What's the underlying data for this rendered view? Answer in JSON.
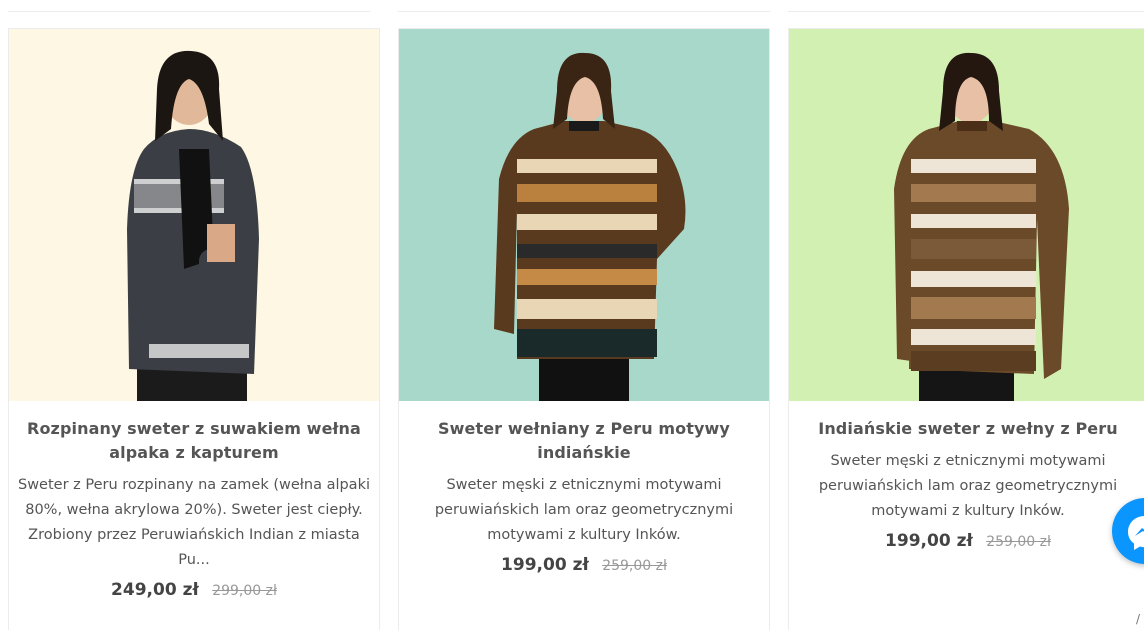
{
  "products": [
    {
      "title": "Rozpinany sweter z suwakiem wełna alpaka z kapturem",
      "description": "Sweter z Peru rozpinany na zamek (wełna alpaki 80%, wełna akrylowa 20%). Sweter jest ciepły. Zrobiony przez Peruwiańskich Indian z miasta Pu...",
      "price": "249,00 zł",
      "old_price": "299,00 zł",
      "background": "#fdf7e3"
    },
    {
      "title": "Sweter wełniany z Peru motywy indiańskie",
      "description": "Sweter męski z etnicznymi motywami peruwiańskich lam oraz geometrycznymi motywami z kultury Inków.",
      "price": "199,00 zł",
      "old_price": "259,00 zł",
      "background": "#a8d8ca"
    },
    {
      "title": "Indiańskie sweter z wełny z Peru",
      "description": "Sweter męski z etnicznymi motywami peruwiańskich lam oraz geometrycznymi motywami z kultury Inków.",
      "price": "199,00 zł",
      "old_price": "259,00 zł",
      "background": "#d3f0b3"
    }
  ],
  "messenger": {
    "icon": "messenger-icon",
    "color": "#0a95ff"
  }
}
